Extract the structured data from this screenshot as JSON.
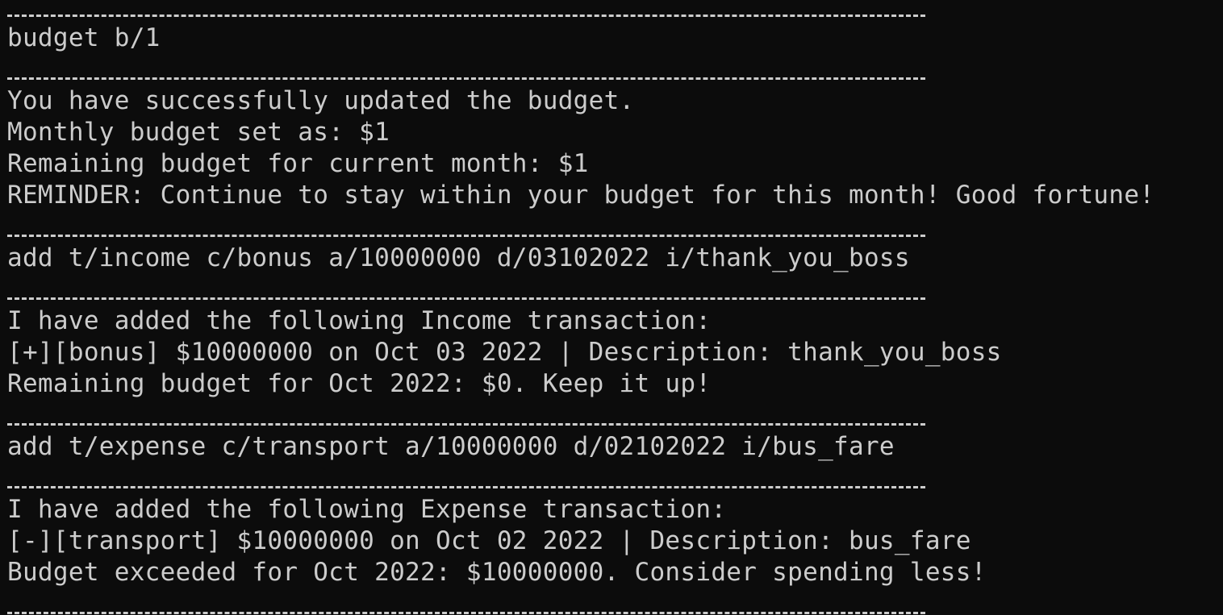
{
  "terminal": {
    "blocks": [
      {
        "kind": "command",
        "text": "budget b/1"
      },
      {
        "kind": "output",
        "lines": [
          "You have successfully updated the budget.",
          "Monthly budget set as: $1",
          "Remaining budget for current month: $1",
          "REMINDER: Continue to stay within your budget for this month! Good fortune!"
        ]
      },
      {
        "kind": "command",
        "text": "add t/income c/bonus a/10000000 d/03102022 i/thank_you_boss"
      },
      {
        "kind": "output",
        "lines": [
          "I have added the following Income transaction:",
          "[+][bonus] $10000000 on Oct 03 2022 | Description: thank_you_boss",
          "Remaining budget for Oct 2022: $0. Keep it up!"
        ]
      },
      {
        "kind": "command",
        "text": "add t/expense c/transport a/10000000 d/02102022 i/bus_fare"
      },
      {
        "kind": "output",
        "lines": [
          "I have added the following Expense transaction:",
          "[-][transport] $10000000 on Oct 02 2022 | Description: bus_fare",
          "Budget exceeded for Oct 2022: $10000000. Consider spending less!"
        ]
      }
    ]
  },
  "colors": {
    "background": "#0c0c0c",
    "foreground": "#cccccc"
  }
}
